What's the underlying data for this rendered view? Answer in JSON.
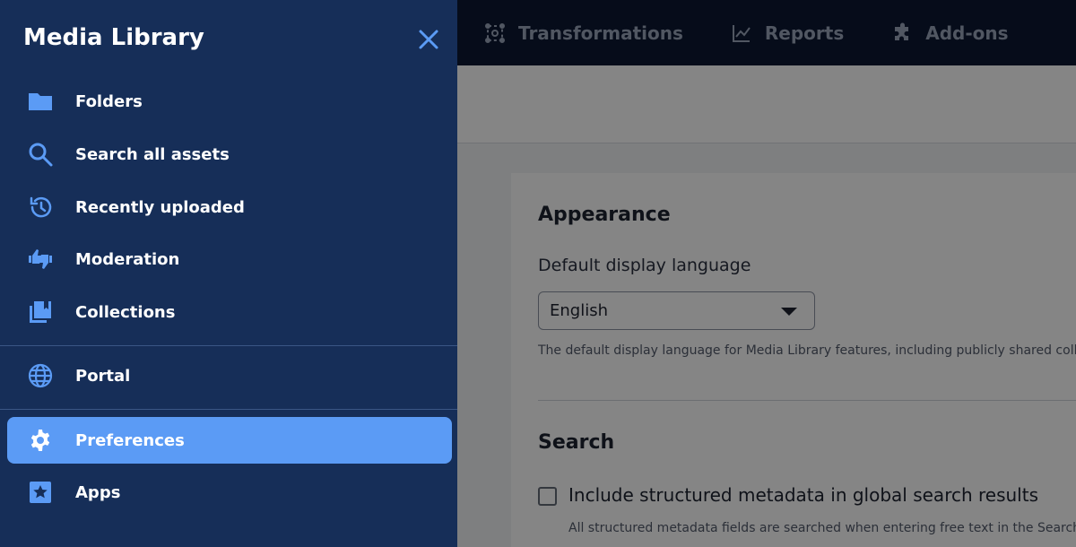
{
  "topnav": {
    "items": [
      {
        "label": "Transformations",
        "icon": "transformations-icon"
      },
      {
        "label": "Reports",
        "icon": "chart-line-icon"
      },
      {
        "label": "Add-ons",
        "icon": "puzzle-icon"
      }
    ]
  },
  "preferences": {
    "appearance_title": "Appearance",
    "language_label": "Default display language",
    "language_value": "English",
    "language_help": "The default display language for Media Library features, including publicly shared collections",
    "search_title": "Search",
    "structured_metadata_label": "Include structured metadata in global search results",
    "structured_metadata_checked": false,
    "structured_metadata_help": "All structured metadata fields are searched when entering free text in the Search bar"
  },
  "drawer": {
    "title": "Media Library",
    "items": [
      {
        "label": "Folders",
        "icon": "folder-icon",
        "active": false
      },
      {
        "label": "Search all assets",
        "icon": "search-icon",
        "active": false
      },
      {
        "label": "Recently uploaded",
        "icon": "history-icon",
        "active": false
      },
      {
        "label": "Moderation",
        "icon": "thumbs-up-down-icon",
        "active": false
      },
      {
        "label": "Collections",
        "icon": "collections-icon",
        "active": false
      },
      {
        "label": "Portal",
        "icon": "globe-icon",
        "active": false
      },
      {
        "label": "Preferences",
        "icon": "gear-icon",
        "active": true
      },
      {
        "label": "Apps",
        "icon": "star-box-icon",
        "active": false
      }
    ]
  },
  "colors": {
    "drawer_bg": "#162e58",
    "active_item_bg": "#5b9bf5",
    "icon_blue": "#5b9bf5",
    "topbar_bg": "#0c1733"
  }
}
